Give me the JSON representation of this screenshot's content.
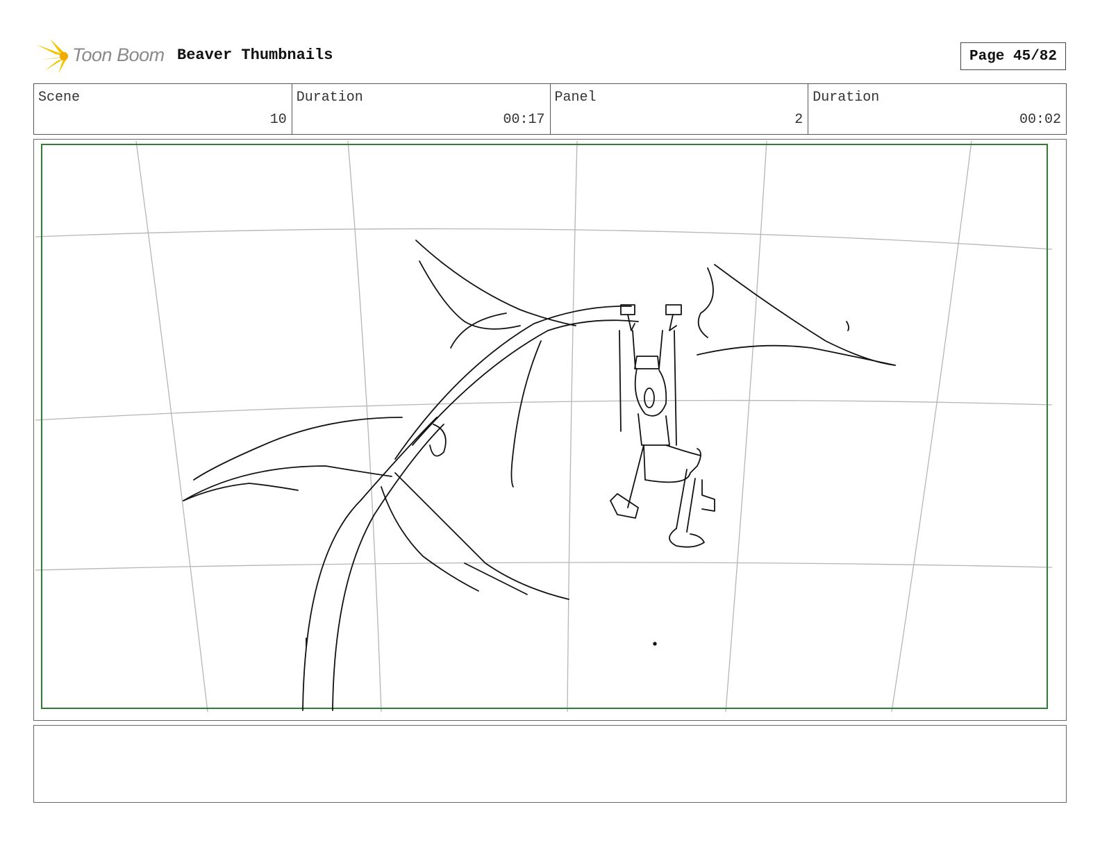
{
  "header": {
    "brand": "Toon Boom",
    "project_title": "Beaver Thumbnails",
    "page_indicator": "Page 45/82"
  },
  "info": {
    "scene_label": "Scene",
    "scene_value": "10",
    "scene_duration_label": "Duration",
    "scene_duration_value": "00:17",
    "panel_label": "Panel",
    "panel_value": "2",
    "panel_duration_label": "Duration",
    "panel_duration_value": "00:02"
  },
  "colors": {
    "safe_frame": "#2e7d32",
    "grid": "#b5b5b5",
    "logo_burst": "#f5c400"
  },
  "notes": {
    "text": ""
  }
}
